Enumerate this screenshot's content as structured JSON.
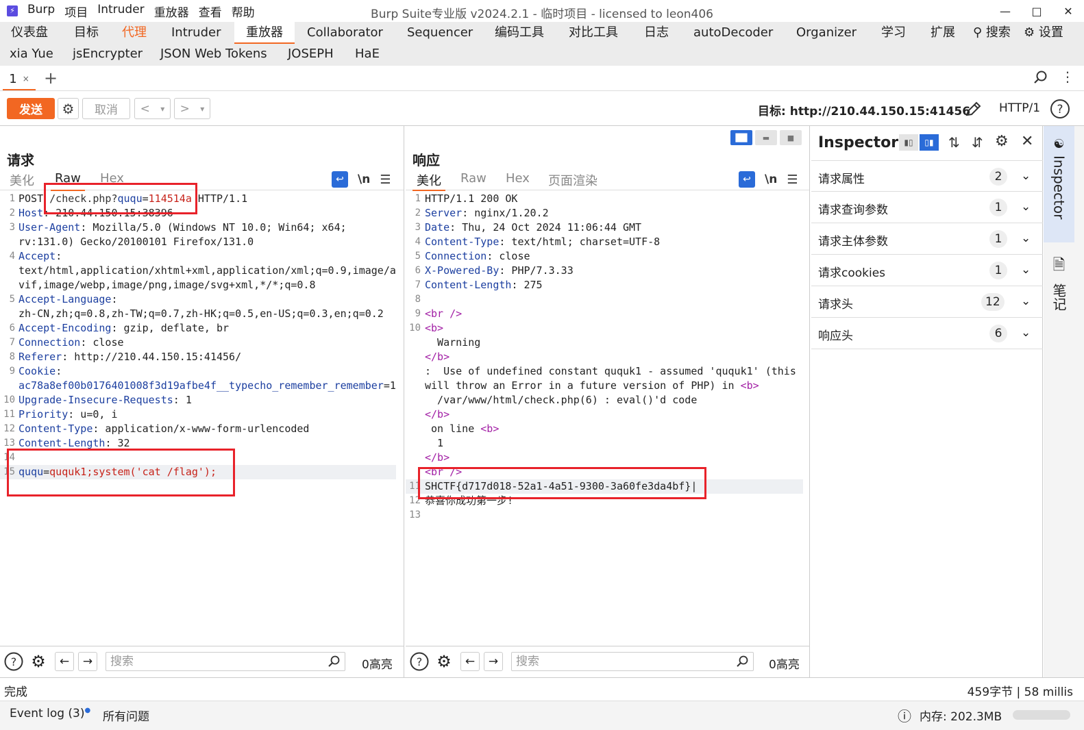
{
  "window": {
    "app_menu": [
      "Burp",
      "项目",
      "Intruder",
      "重放器",
      "查看",
      "帮助"
    ],
    "title": "Burp Suite专业版  v2024.2.1 - 临时项目 - licensed to leon406"
  },
  "main_tabs": {
    "row1": [
      "仪表盘",
      "目标",
      "代理",
      "Intruder",
      "重放器",
      "Collaborator",
      "Sequencer",
      "编码工具",
      "对比工具",
      "日志",
      "autoDecoder",
      "Organizer",
      "学习",
      "扩展"
    ],
    "search": "搜索",
    "settings": "设置",
    "row2": [
      "xia Yue",
      "jsEncrypter",
      "JSON Web Tokens",
      "JOSEPH",
      "HaE"
    ],
    "active": "重放器",
    "alert": "代理"
  },
  "repeater_tabs": {
    "tab_label": "1",
    "close": "×",
    "add": "+"
  },
  "toolbar": {
    "send": "发送",
    "cancel": "取消",
    "back": "<",
    "forward": ">",
    "dropdown": "▾",
    "target_label": "目标: http://210.44.150.15:41456",
    "http_version": "HTTP/1"
  },
  "request": {
    "title": "请求",
    "tabs": [
      "美化",
      "Raw",
      "Hex"
    ],
    "active_tab": "Raw",
    "newline_toggle": "\\n",
    "search_placeholder": "搜索",
    "highlights": "0高亮"
  },
  "response": {
    "title": "响应",
    "tabs": [
      "美化",
      "Raw",
      "Hex",
      "页面渲染"
    ],
    "active_tab": "美化",
    "newline_toggle": "\\n",
    "search_placeholder": "搜索",
    "highlights": "0高亮"
  },
  "inspector": {
    "title": "Inspector",
    "sections": [
      {
        "label": "请求属性",
        "count": "2"
      },
      {
        "label": "请求查询参数",
        "count": "1"
      },
      {
        "label": "请求主体参数",
        "count": "1"
      },
      {
        "label": "请求cookies",
        "count": "1"
      },
      {
        "label": "请求头",
        "count": "12"
      },
      {
        "label": "响应头",
        "count": "6"
      }
    ],
    "side_tab": "Inspector",
    "notes_tab": "笔记"
  },
  "status": {
    "left": "完成",
    "right": "459字节 | 58 millis"
  },
  "footer": {
    "event_log": "Event log (3)",
    "issues": "所有问题",
    "memory": "内存: 202.3MB"
  }
}
